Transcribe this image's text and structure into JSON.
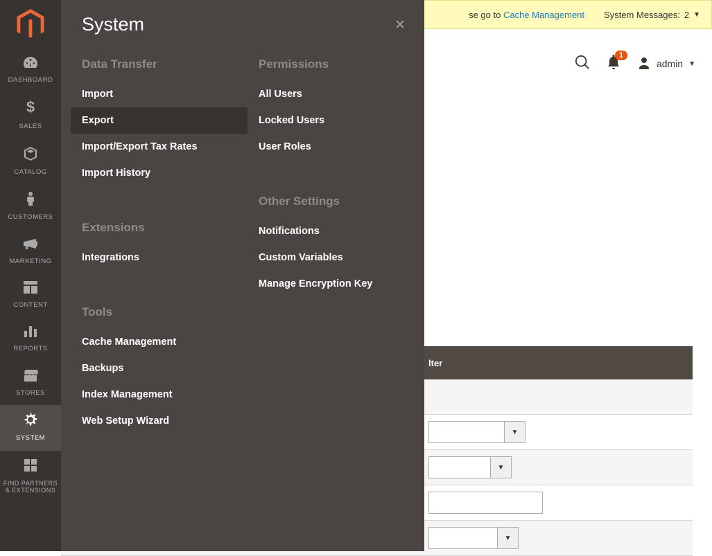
{
  "sidebar": {
    "items": [
      {
        "label": "DASHBOARD",
        "icon": "dashboard"
      },
      {
        "label": "SALES",
        "icon": "dollar"
      },
      {
        "label": "CATALOG",
        "icon": "box"
      },
      {
        "label": "CUSTOMERS",
        "icon": "person"
      },
      {
        "label": "MARKETING",
        "icon": "megaphone"
      },
      {
        "label": "CONTENT",
        "icon": "layout"
      },
      {
        "label": "REPORTS",
        "icon": "bars"
      },
      {
        "label": "STORES",
        "icon": "storefront"
      },
      {
        "label": "SYSTEM",
        "icon": "gear"
      },
      {
        "label": "FIND PARTNERS & EXTENSIONS",
        "icon": "blocks"
      }
    ]
  },
  "flyout": {
    "title": "System",
    "columns": [
      {
        "sections": [
          {
            "title": "Data Transfer",
            "links": [
              {
                "label": "Import",
                "selected": false
              },
              {
                "label": "Export",
                "selected": true
              },
              {
                "label": "Import/Export Tax Rates",
                "selected": false
              },
              {
                "label": "Import History",
                "selected": false
              }
            ]
          },
          {
            "title": "Extensions",
            "links": [
              {
                "label": "Integrations",
                "selected": false
              }
            ]
          },
          {
            "title": "Tools",
            "links": [
              {
                "label": "Cache Management",
                "selected": false
              },
              {
                "label": "Backups",
                "selected": false
              },
              {
                "label": "Index Management",
                "selected": false
              },
              {
                "label": "Web Setup Wizard",
                "selected": false
              }
            ]
          }
        ]
      },
      {
        "sections": [
          {
            "title": "Permissions",
            "links": [
              {
                "label": "All Users",
                "selected": false
              },
              {
                "label": "Locked Users",
                "selected": false
              },
              {
                "label": "User Roles",
                "selected": false
              }
            ]
          },
          {
            "title": "Other Settings",
            "links": [
              {
                "label": "Notifications",
                "selected": false
              },
              {
                "label": "Custom Variables",
                "selected": false
              },
              {
                "label": "Manage Encryption Key",
                "selected": false
              }
            ]
          }
        ]
      }
    ]
  },
  "messages": {
    "text_prefix": "se go to ",
    "link": "Cache Management",
    "system_label": "System Messages:",
    "system_count": "2"
  },
  "header": {
    "badge": "1",
    "user": "admin"
  },
  "table": {
    "col_header_fragment": "lter"
  }
}
